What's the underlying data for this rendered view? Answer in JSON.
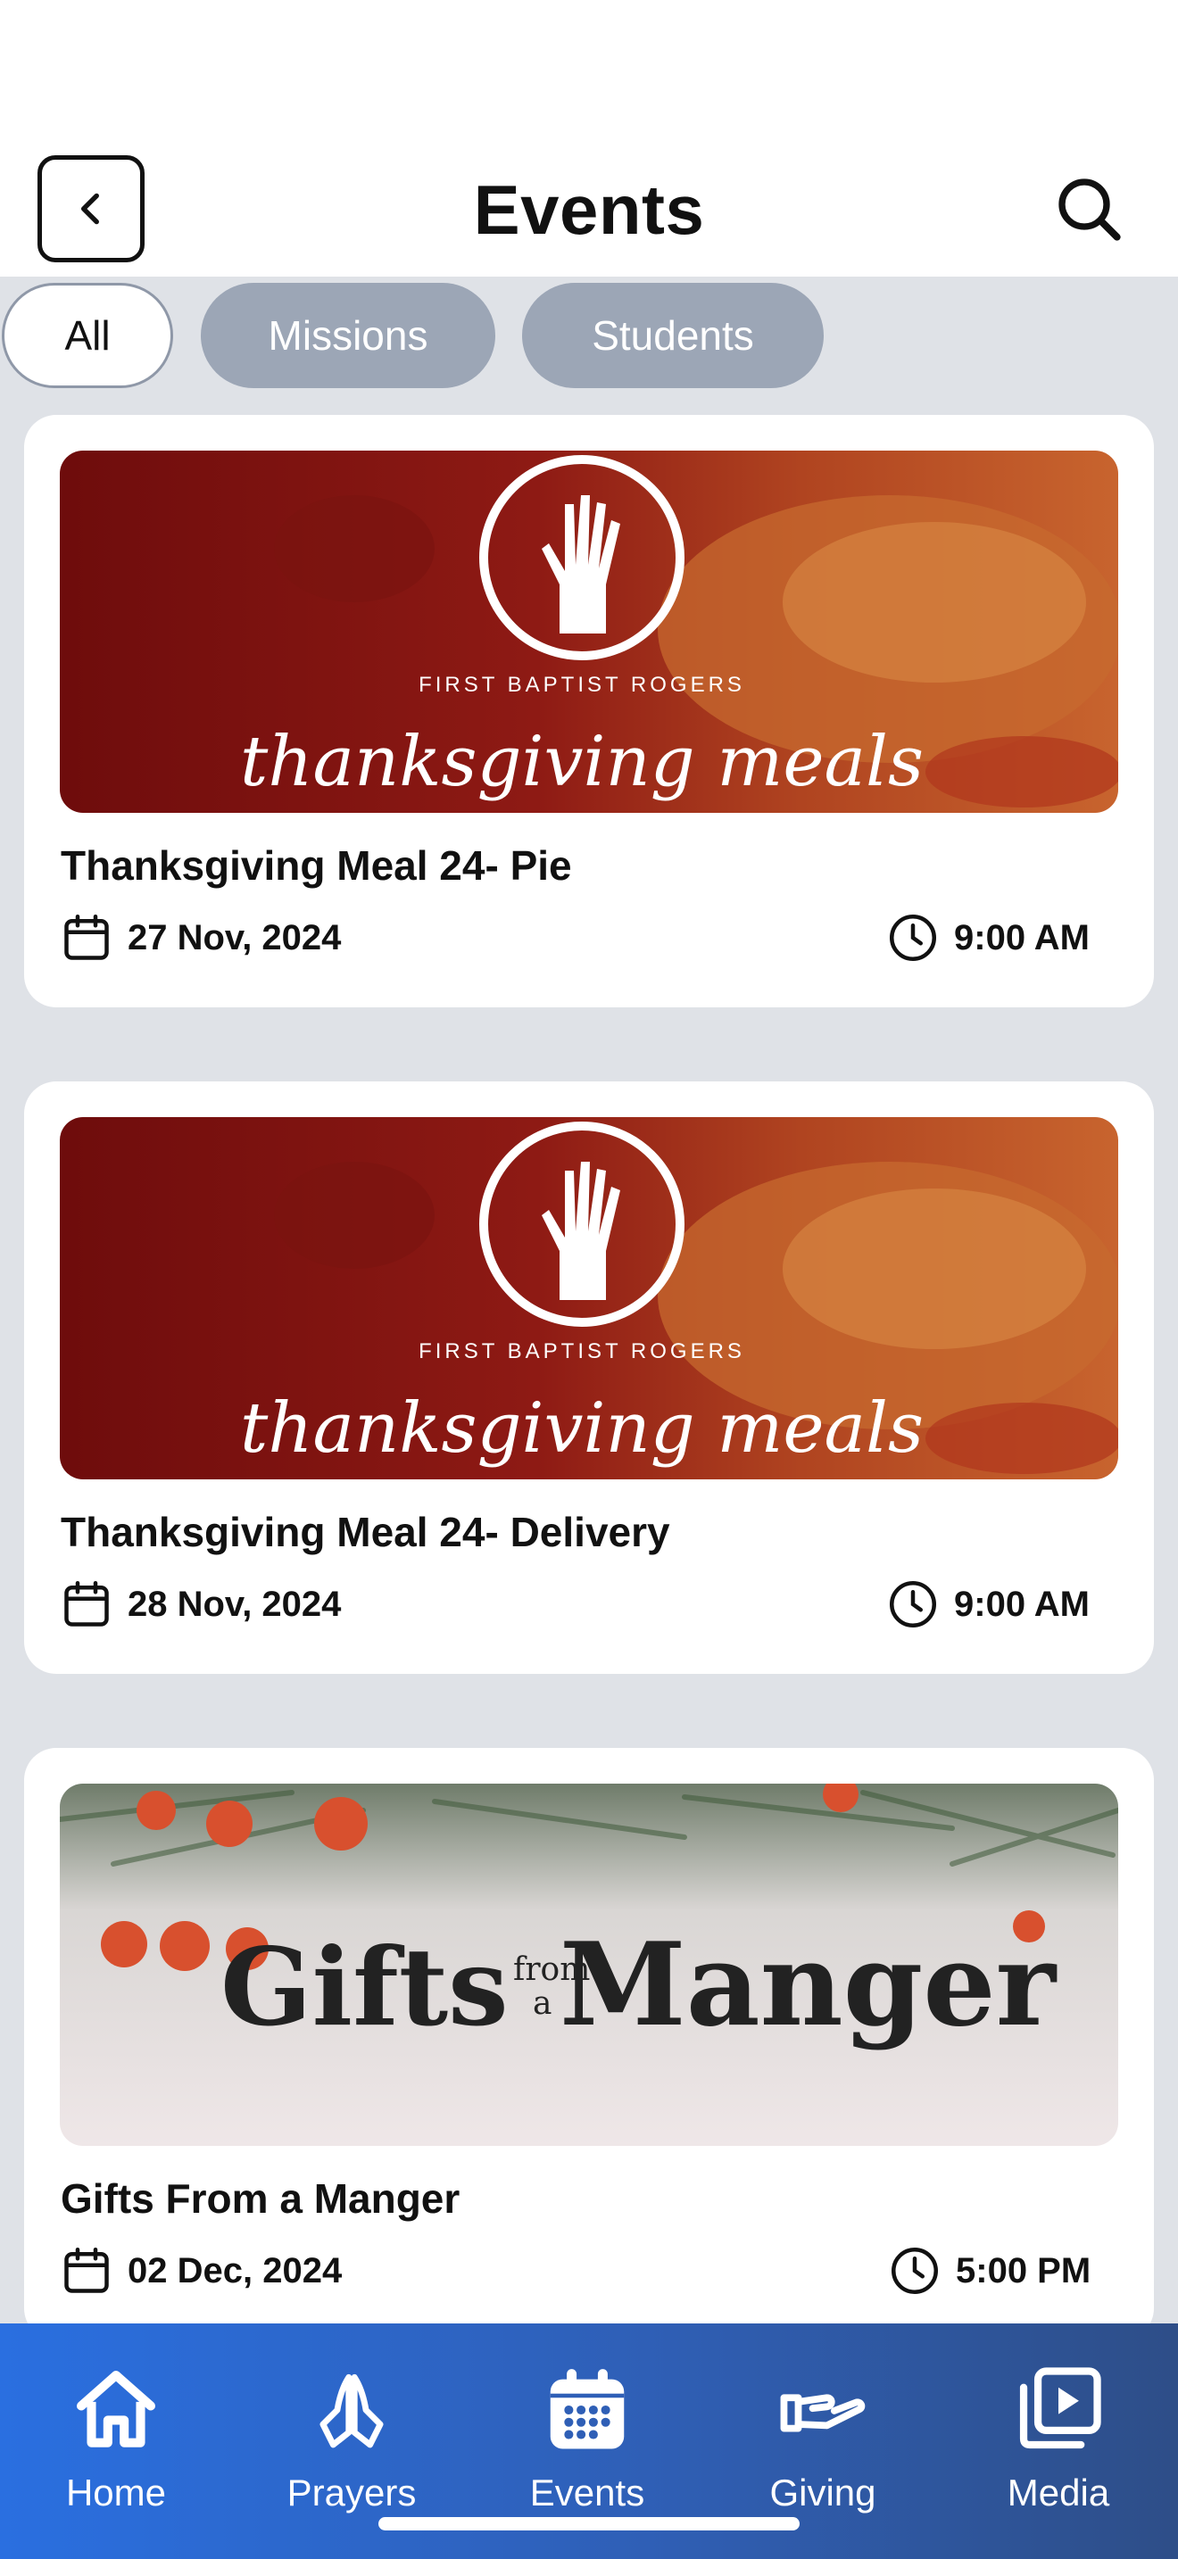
{
  "header": {
    "title": "Events"
  },
  "filters": [
    {
      "label": "All",
      "active": true
    },
    {
      "label": "Missions",
      "active": false
    },
    {
      "label": "Students",
      "active": false
    }
  ],
  "events": [
    {
      "title": "Thanksgiving Meal 24- Pie",
      "date": "27 Nov, 2024",
      "time": "9:00 AM",
      "banner": {
        "org": "FIRST BAPTIST ROGERS",
        "script": "thanksgiving meals"
      }
    },
    {
      "title": "Thanksgiving Meal 24- Delivery",
      "date": "28 Nov, 2024",
      "time": "9:00 AM",
      "banner": {
        "org": "FIRST BAPTIST ROGERS",
        "script": "thanksgiving meals"
      }
    },
    {
      "title": "Gifts From a Manger",
      "date": "02 Dec, 2024",
      "time": "5:00 PM",
      "banner": {
        "left": "Gifts",
        "small_top": "from",
        "small_bottom": "a",
        "right": "Manger"
      }
    }
  ],
  "tabbar": [
    {
      "label": "Home",
      "icon": "home-icon",
      "active": false
    },
    {
      "label": "Prayers",
      "icon": "praying-hands-icon",
      "active": false
    },
    {
      "label": "Events",
      "icon": "calendar-icon",
      "active": true
    },
    {
      "label": "Giving",
      "icon": "giving-hand-icon",
      "active": false
    },
    {
      "label": "Media",
      "icon": "media-play-icon",
      "active": false
    }
  ],
  "colors": {
    "tabbar_gradient_start": "#2a6fe0",
    "tabbar_gradient_end": "#2e4e88",
    "background": "#dfe2e7",
    "chip_inactive": "#9ca6b6"
  }
}
